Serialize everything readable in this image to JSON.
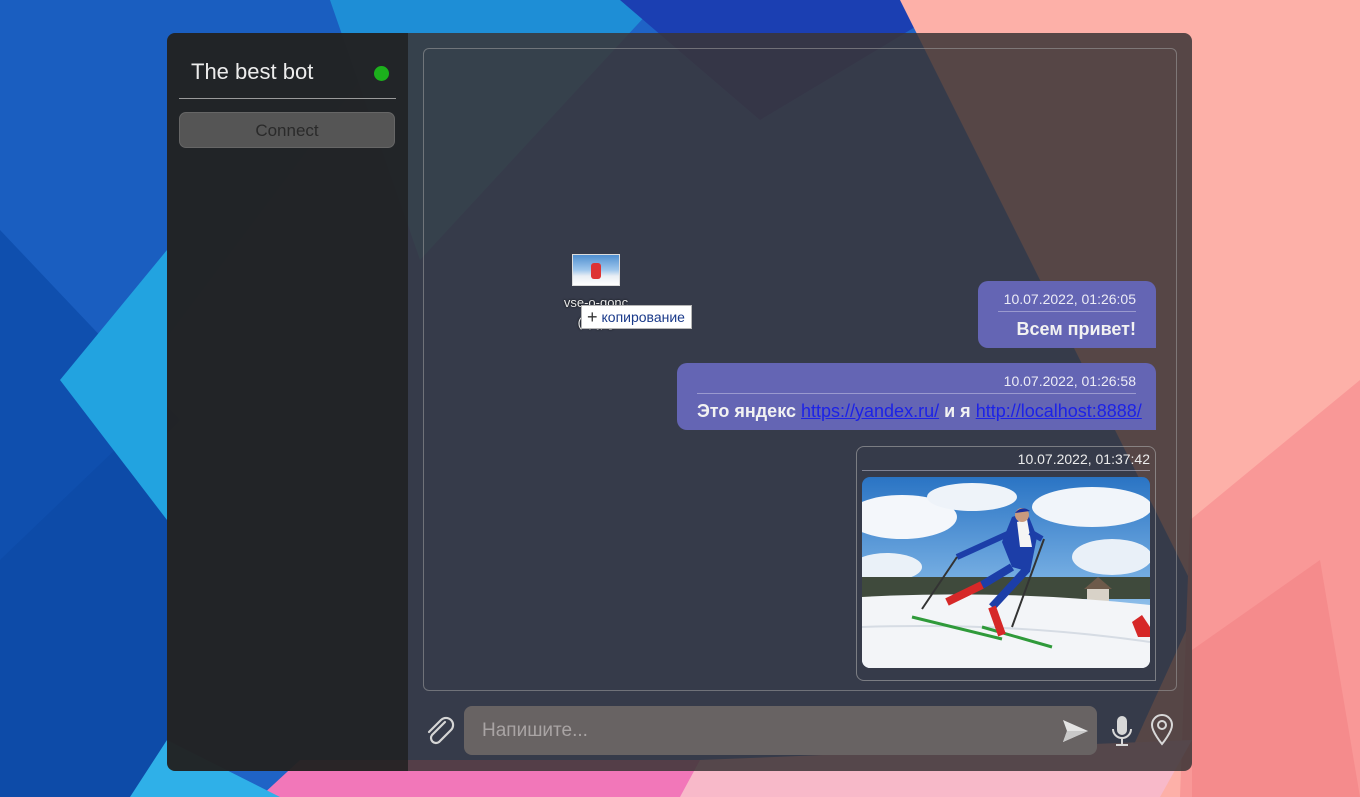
{
  "sidebar": {
    "bot_name": "The best bot",
    "status_color": "#1cb01c",
    "connect_label": "Connect"
  },
  "drag": {
    "file_name": "vse-o-gonc (1).jpg",
    "tooltip_label": "копирование",
    "tooltip_icon": "plus-icon"
  },
  "messages": [
    {
      "time": "10.07.2022, 01:26:05",
      "text": "Всем привет!"
    },
    {
      "time": "10.07.2022, 01:26:58",
      "text_before": "Это яндекс",
      "link1": "https://yandex.ru/",
      "text_middle": "и я",
      "link2": "http://localhost:8888/"
    },
    {
      "time": "10.07.2022, 01:37:42",
      "image": "skier-photo"
    }
  ],
  "composer": {
    "placeholder": "Напишите...",
    "attach_icon": "paperclip-icon",
    "send_icon": "send-icon",
    "mic_icon": "microphone-icon",
    "location_icon": "location-pin-icon"
  },
  "colors": {
    "bubble": "#6465b4",
    "link": "#1c22e6",
    "online": "#1cb01c"
  }
}
